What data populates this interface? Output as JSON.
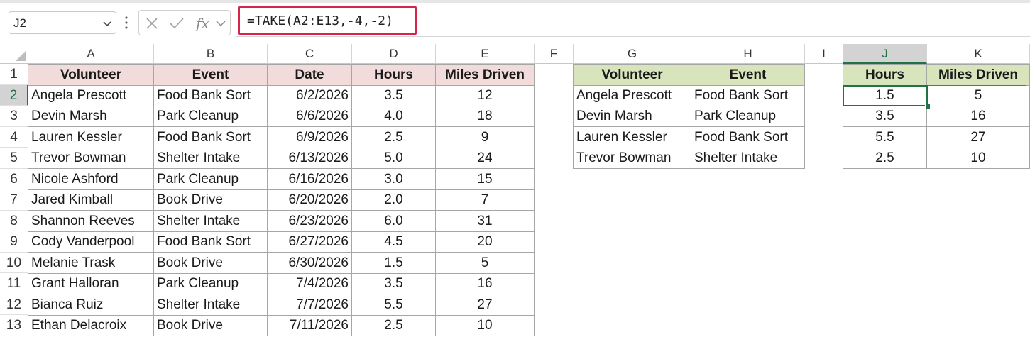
{
  "name_box": {
    "value": "J2"
  },
  "formula_bar": {
    "formula": "=TAKE(A2:E13,-4,-2)"
  },
  "icons": [
    "chevron-down-icon",
    "vertical-dots-icon",
    "cancel-x-icon",
    "enter-check-icon",
    "insert-function-fx-icon",
    "fx-chevron-icon",
    "select-all-triangle-icon"
  ],
  "colors": {
    "pink_header": "#f2dcdb",
    "green_header": "#d8e4bc",
    "formula_highlight": "#d6244a",
    "selection": "#217346",
    "spill": "#3f6fb5"
  },
  "columns": [
    "A",
    "B",
    "C",
    "D",
    "E",
    "F",
    "G",
    "H",
    "I",
    "J",
    "K"
  ],
  "selected_column": "J",
  "rows": [
    "1",
    "2",
    "3",
    "4",
    "5",
    "6",
    "7",
    "8",
    "9",
    "10",
    "11",
    "12",
    "13"
  ],
  "selected_row": "2",
  "source_table": {
    "headers": [
      "Volunteer",
      "Event",
      "Date",
      "Hours",
      "Miles Driven"
    ],
    "rows": [
      [
        "Angela Prescott",
        "Food Bank Sort",
        "6/2/2026",
        "3.5",
        "12"
      ],
      [
        "Devin Marsh",
        "Park Cleanup",
        "6/6/2026",
        "4.0",
        "18"
      ],
      [
        "Lauren Kessler",
        "Food Bank Sort",
        "6/9/2026",
        "2.5",
        "9"
      ],
      [
        "Trevor Bowman",
        "Shelter Intake",
        "6/13/2026",
        "5.0",
        "24"
      ],
      [
        "Nicole Ashford",
        "Park Cleanup",
        "6/16/2026",
        "3.0",
        "15"
      ],
      [
        "Jared Kimball",
        "Book Drive",
        "6/20/2026",
        "2.0",
        "7"
      ],
      [
        "Shannon Reeves",
        "Shelter Intake",
        "6/23/2026",
        "6.0",
        "31"
      ],
      [
        "Cody Vanderpool",
        "Food Bank Sort",
        "6/27/2026",
        "4.5",
        "20"
      ],
      [
        "Melanie Trask",
        "Book Drive",
        "6/30/2026",
        "1.5",
        "5"
      ],
      [
        "Grant Halloran",
        "Park Cleanup",
        "7/4/2026",
        "3.5",
        "16"
      ],
      [
        "Bianca Ruiz",
        "Shelter Intake",
        "7/7/2026",
        "5.5",
        "27"
      ],
      [
        "Ethan Delacroix",
        "Book Drive",
        "7/11/2026",
        "2.5",
        "10"
      ]
    ]
  },
  "gh_table": {
    "headers": [
      "Volunteer",
      "Event"
    ],
    "rows": [
      [
        "Angela Prescott",
        "Food Bank Sort"
      ],
      [
        "Devin Marsh",
        "Park Cleanup"
      ],
      [
        "Lauren Kessler",
        "Food Bank Sort"
      ],
      [
        "Trevor Bowman",
        "Shelter Intake"
      ]
    ]
  },
  "jk_table": {
    "headers": [
      "Hours",
      "Miles Driven"
    ],
    "rows": [
      [
        "1.5",
        "5"
      ],
      [
        "3.5",
        "16"
      ],
      [
        "5.5",
        "27"
      ],
      [
        "2.5",
        "10"
      ]
    ]
  }
}
